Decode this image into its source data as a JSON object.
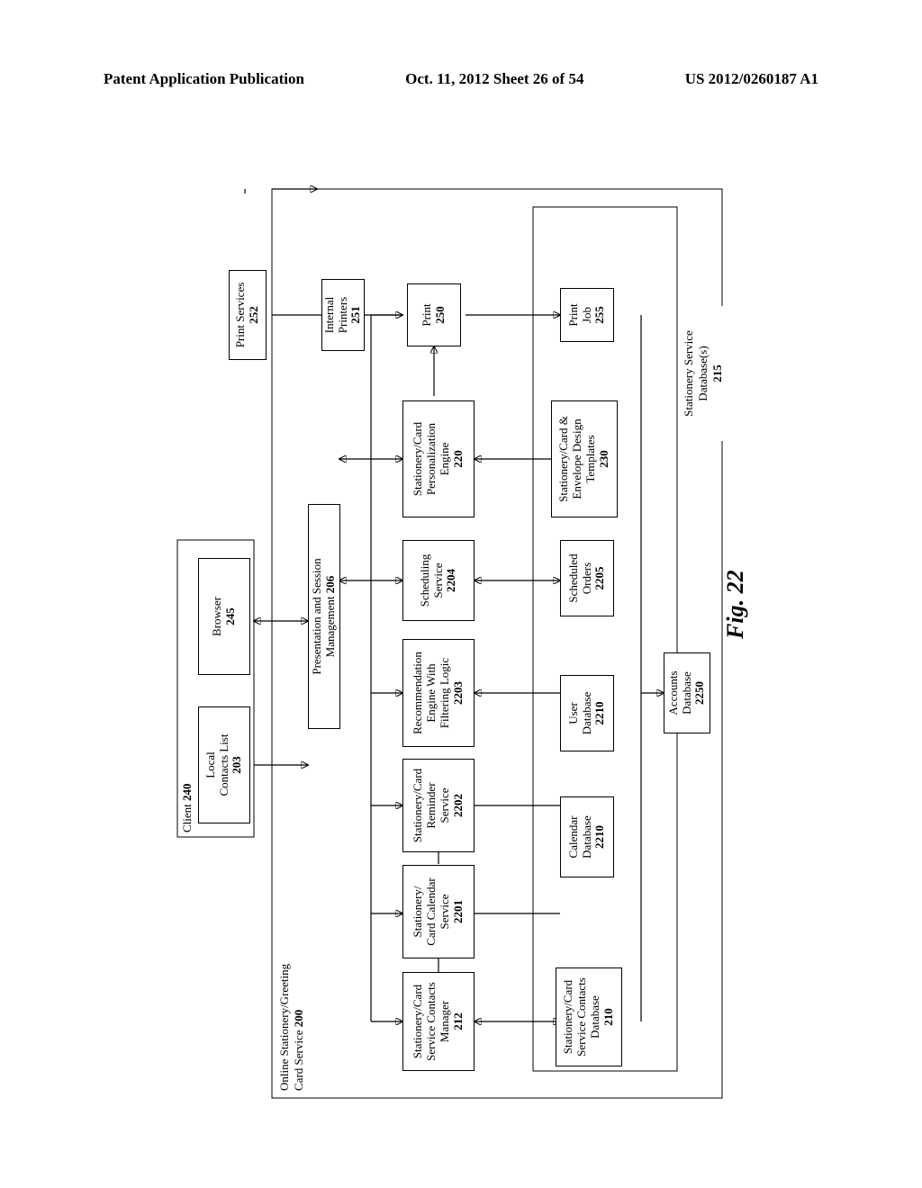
{
  "header": {
    "left": "Patent Application Publication",
    "center": "Oct. 11, 2012   Sheet 26 of 54",
    "right": "US 2012/0260187 A1"
  },
  "figure_label": "Fig. 22",
  "client": {
    "title": "Client",
    "title_ref": "240",
    "local_contacts": {
      "l1": "Local",
      "l2": "Contacts List",
      "ref": "203"
    },
    "browser": {
      "l1": "Browser",
      "ref": "245"
    }
  },
  "service": {
    "title_l1": "Online Stationery/Greeting",
    "title_l2": "Card Service",
    "title_ref": "200",
    "presentation": {
      "l1": "Presentation and Session",
      "l2": "Management",
      "ref": "206"
    },
    "contacts_mgr": {
      "l1": "Stationery/Card",
      "l2": "Service Contacts",
      "l3": "Manager",
      "ref": "212"
    },
    "calendar_svc": {
      "l1": "Stationery/",
      "l2": "Card Calendar",
      "l3": "Service",
      "ref": "2201"
    },
    "reminder_svc": {
      "l1": "Stationery/Card",
      "l2": "Reminder",
      "l3": "Service",
      "ref": "2202"
    },
    "recommendation": {
      "l1": "Recommendation",
      "l2": "Engine With",
      "l3": "Filtering Logic",
      "ref": "2203"
    },
    "scheduling": {
      "l1": "Scheduling",
      "l2": "Service",
      "ref": "2204"
    },
    "personalization": {
      "l1": "Stationery/Card",
      "l2": "Personalization",
      "l3": "Engine",
      "ref": "220"
    },
    "print": {
      "l1": "Print",
      "ref": "250"
    },
    "internal_printers": {
      "l1": "Internal",
      "l2": "Printers",
      "ref": "251"
    },
    "print_services": {
      "l1": "Print Services",
      "ref": "252"
    },
    "db_group_label": {
      "l1": "Stationery Service",
      "l2": "Database(s)",
      "ref": "215"
    },
    "contacts_db": {
      "l1": "Stationery/Card",
      "l2": "Service Contacts",
      "l3": "Database",
      "ref": "210"
    },
    "calendar_db": {
      "l1": "Calendar",
      "l2": "Database",
      "ref": "2210"
    },
    "user_db": {
      "l1": "User",
      "l2": "Database",
      "ref": "2210"
    },
    "scheduled_orders": {
      "l1": "Scheduled",
      "l2": "Orders",
      "ref": "2205"
    },
    "templates": {
      "l1": "Stationery/Card &",
      "l2": "Envelope Design",
      "l3": "Templates",
      "ref": "230"
    },
    "print_job": {
      "l1": "Print",
      "l2": "Job",
      "ref": "255"
    },
    "accounts_db": {
      "l1": "Accounts",
      "l2": "Database",
      "ref": "2250"
    }
  }
}
